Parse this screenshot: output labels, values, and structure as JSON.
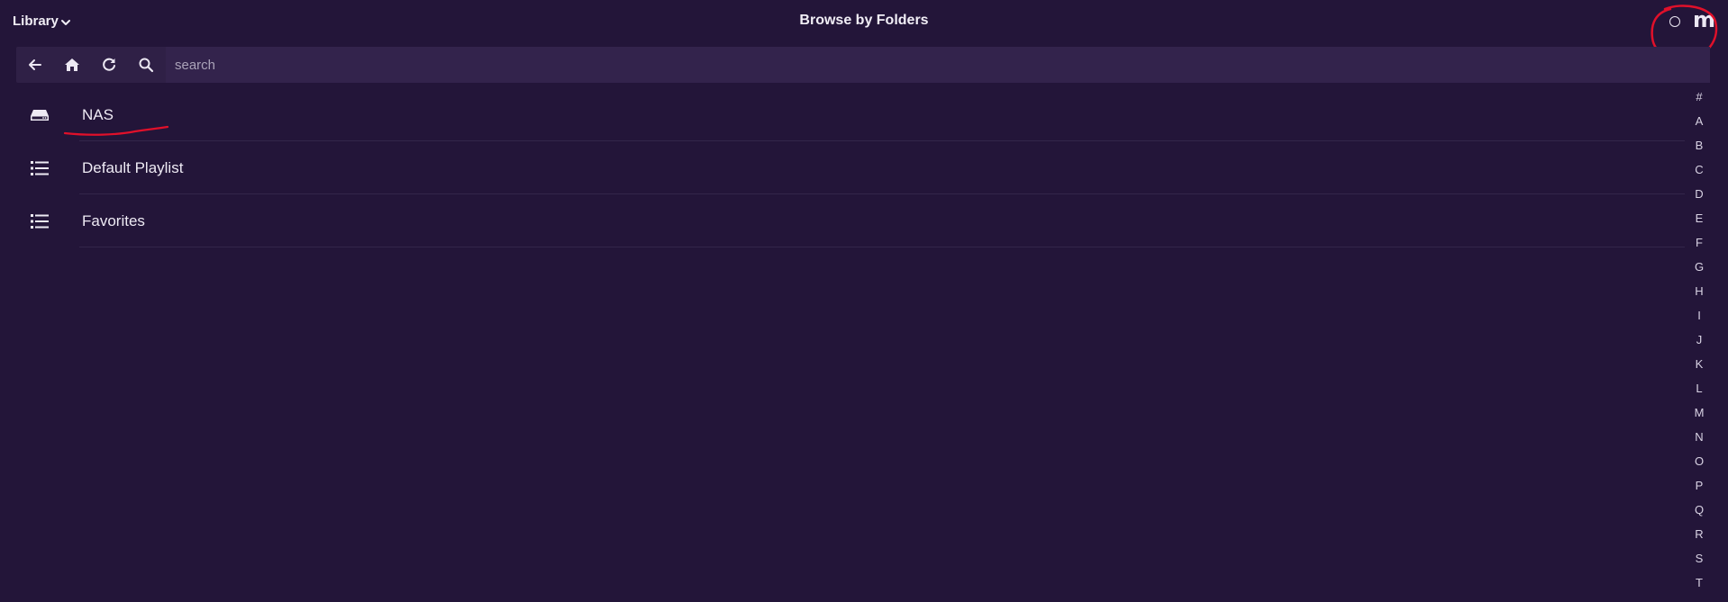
{
  "header": {
    "library_label": "Library",
    "title": "Browse by Folders",
    "logo_text": "m"
  },
  "toolbar": {
    "search_placeholder": "search",
    "search_value": ""
  },
  "items": [
    {
      "label": "NAS",
      "icon": "drive-icon"
    },
    {
      "label": "Default Playlist",
      "icon": "list-icon"
    },
    {
      "label": "Favorites",
      "icon": "list-icon"
    }
  ],
  "alphabet": [
    "#",
    "A",
    "B",
    "C",
    "D",
    "E",
    "F",
    "G",
    "H",
    "I",
    "J",
    "K",
    "L",
    "M",
    "N",
    "O",
    "P",
    "Q",
    "R",
    "S",
    "T"
  ],
  "colors": {
    "background": "#231539",
    "toolbar": "#2f2046",
    "text": "#eeeaf4",
    "annotation": "#e0102a"
  }
}
